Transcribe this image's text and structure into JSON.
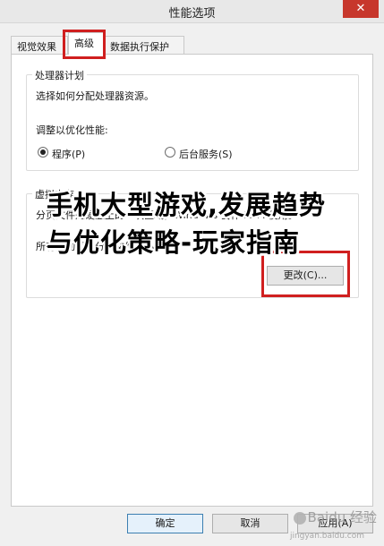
{
  "window": {
    "title": "性能选项",
    "close_glyph": "✕"
  },
  "tabs": [
    {
      "label": "视觉效果",
      "active": false
    },
    {
      "label": "高级",
      "active": true
    },
    {
      "label": "数据执行保护",
      "active": false
    }
  ],
  "processor": {
    "legend": "处理器计划",
    "description": "选择如何分配处理器资源。",
    "adjust_label": "调整以优化性能:",
    "options": [
      {
        "label": "程序(P)",
        "checked": true
      },
      {
        "label": "后台服务(S)",
        "checked": false
      }
    ]
  },
  "virtual_memory": {
    "legend": "虚拟内存",
    "line1": "分页文件是硬盘上的一块区域，Windows 当作 RAM 使用。",
    "line2": "所有驱动器总分页文件大小:        MB",
    "change_button": "更改(C)..."
  },
  "footer": {
    "ok": "确定",
    "cancel": "取消",
    "apply": "应用(A)"
  },
  "overlay": {
    "headline": "手机大型游戏,发展趋势与优化策略-玩家指南"
  },
  "watermark": {
    "brand": "Baidu 经验",
    "sub": "jingyan.baidu.com"
  },
  "colors": {
    "highlight": "#d01f1f",
    "close": "#c7372c"
  }
}
